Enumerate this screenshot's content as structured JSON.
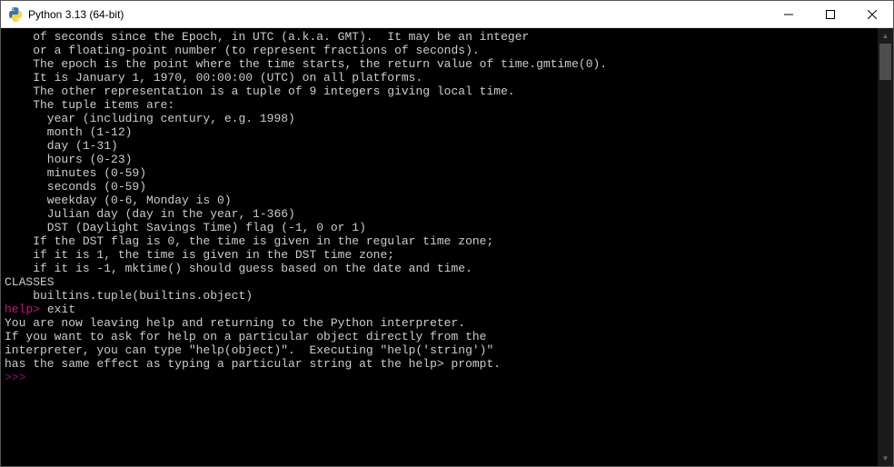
{
  "window": {
    "title": "Python 3.13 (64-bit)"
  },
  "terminal": {
    "lines": [
      {
        "indent": "    ",
        "text": "of seconds since the Epoch, in UTC (a.k.a. GMT).  It may be an integer"
      },
      {
        "indent": "    ",
        "text": "or a floating-point number (to represent fractions of seconds)."
      },
      {
        "indent": "    ",
        "text": "The epoch is the point where the time starts, the return value of time.gmtime(0)."
      },
      {
        "indent": "    ",
        "text": "It is January 1, 1970, 00:00:00 (UTC) on all platforms."
      },
      {
        "indent": "",
        "text": ""
      },
      {
        "indent": "    ",
        "text": "The other representation is a tuple of 9 integers giving local time."
      },
      {
        "indent": "    ",
        "text": "The tuple items are:"
      },
      {
        "indent": "      ",
        "text": "year (including century, e.g. 1998)"
      },
      {
        "indent": "      ",
        "text": "month (1-12)"
      },
      {
        "indent": "      ",
        "text": "day (1-31)"
      },
      {
        "indent": "      ",
        "text": "hours (0-23)"
      },
      {
        "indent": "      ",
        "text": "minutes (0-59)"
      },
      {
        "indent": "      ",
        "text": "seconds (0-59)"
      },
      {
        "indent": "      ",
        "text": "weekday (0-6, Monday is 0)"
      },
      {
        "indent": "      ",
        "text": "Julian day (day in the year, 1-366)"
      },
      {
        "indent": "      ",
        "text": "DST (Daylight Savings Time) flag (-1, 0 or 1)"
      },
      {
        "indent": "    ",
        "text": "If the DST flag is 0, the time is given in the regular time zone;"
      },
      {
        "indent": "    ",
        "text": "if it is 1, the time is given in the DST time zone;"
      },
      {
        "indent": "    ",
        "text": "if it is -1, mktime() should guess based on the date and time."
      },
      {
        "indent": "",
        "text": ""
      },
      {
        "indent": "",
        "text": "CLASSES"
      },
      {
        "indent": "    ",
        "text": "builtins.tuple(builtins.object)"
      },
      {
        "indent": "",
        "text": ""
      }
    ],
    "help_prompt": "help> ",
    "help_input": "exit",
    "exit_lines": [
      "",
      "You are now leaving help and returning to the Python interpreter.",
      "If you want to ask for help on a particular object directly from the",
      "interpreter, you can type \"help(object)\".  Executing \"help('string')\"",
      "has the same effect as typing a particular string at the help> prompt."
    ],
    "python_prompt": ">>> "
  }
}
